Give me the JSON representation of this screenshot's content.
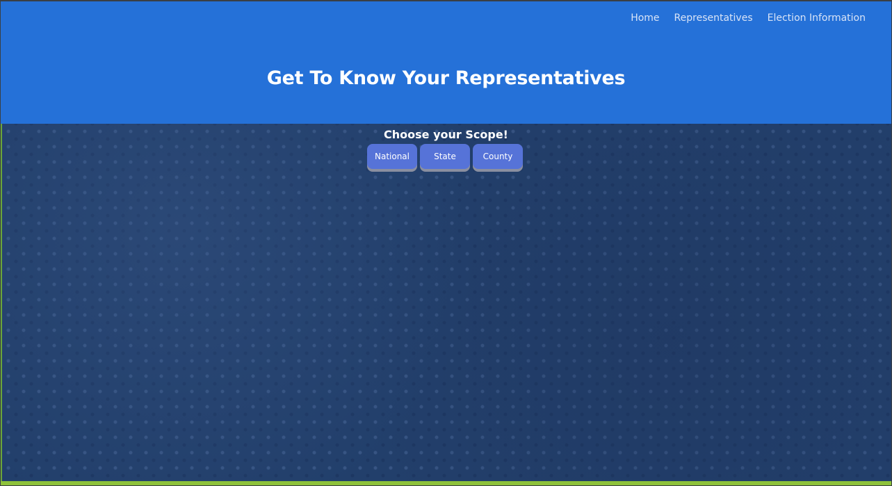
{
  "nav": {
    "items": [
      {
        "label": "Home"
      },
      {
        "label": "Representatives"
      },
      {
        "label": "Election Information"
      }
    ]
  },
  "header": {
    "title": "Get To Know Your Representatives"
  },
  "scope": {
    "label": "Choose your Scope!",
    "buttons": [
      {
        "label": "National"
      },
      {
        "label": "State"
      },
      {
        "label": "County"
      }
    ]
  },
  "colors": {
    "header_bg": "#2571d8",
    "content_bg": "#223f6b",
    "button_bg": "#5673d8",
    "footer_accent": "#8ec23a"
  }
}
